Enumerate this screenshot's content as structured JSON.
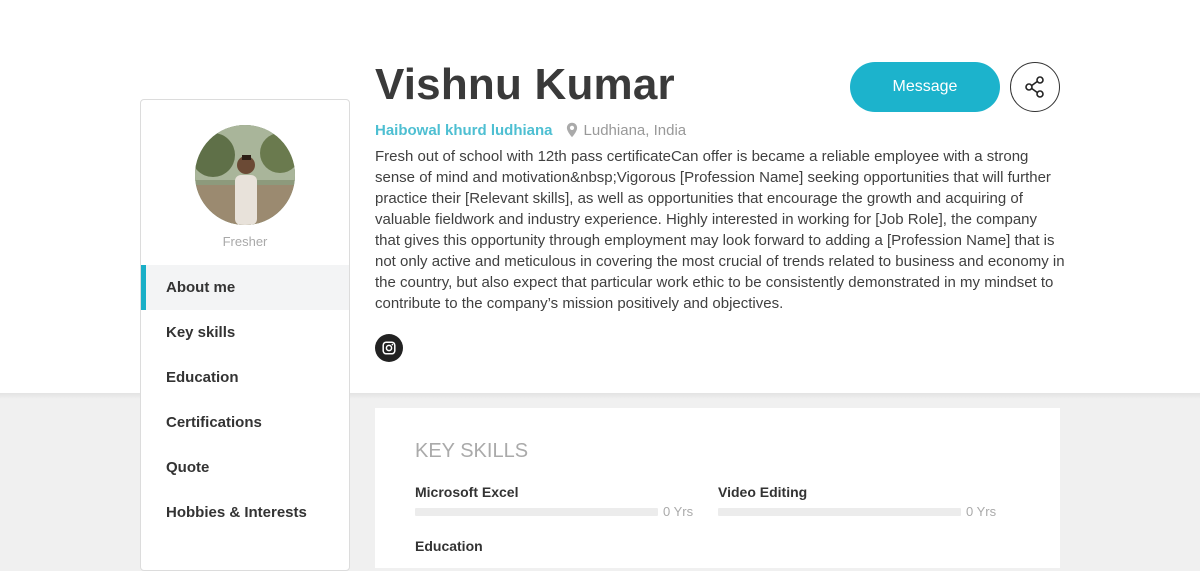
{
  "profile": {
    "name": "Vishnu Kumar",
    "status": "Fresher",
    "location_link": "Haibowal khurd ludhiana",
    "location": "Ludhiana, India",
    "about": "Fresh out of school with 12th pass certificateCan offer is became a reliable employee with a strong sense of mind and motivation&nbsp;Vigorous [Profession Name] seeking opportunities that will further practice their [Relevant skills], as well as opportunities that encourage the growth and acquiring of valuable fieldwork and industry experience. Highly interested in working for [Job Role], the company that gives this opportunity through employment may look forward to adding a [Profession Name] that is not only active and meticulous in covering the most crucial of trends related to business and economy in the country, but also expect that particular work ethic to be consistently demonstrated in my mindset to contribute to the company’s mission positively and objectives."
  },
  "actions": {
    "message_label": "Message"
  },
  "icons": {
    "share": "share-icon",
    "location": "map-pin-icon",
    "social": "instagram-icon"
  },
  "nav": {
    "items": [
      {
        "label": "About me",
        "active": true
      },
      {
        "label": "Key skills",
        "active": false
      },
      {
        "label": "Education",
        "active": false
      },
      {
        "label": "Certifications",
        "active": false
      },
      {
        "label": "Quote",
        "active": false
      },
      {
        "label": "Hobbies & Interests",
        "active": false
      }
    ]
  },
  "skills": {
    "title": "KEY SKILLS",
    "items": [
      {
        "name": "Microsoft Excel",
        "years": "0 Yrs",
        "level": 0
      },
      {
        "name": "Video Editing",
        "years": "0 Yrs",
        "level": 0
      },
      {
        "name": "Education",
        "years": "",
        "level": 0
      }
    ]
  },
  "colors": {
    "accent": "#1cb3cc",
    "link": "#4ebfd2",
    "background": "#f0f0f0"
  }
}
